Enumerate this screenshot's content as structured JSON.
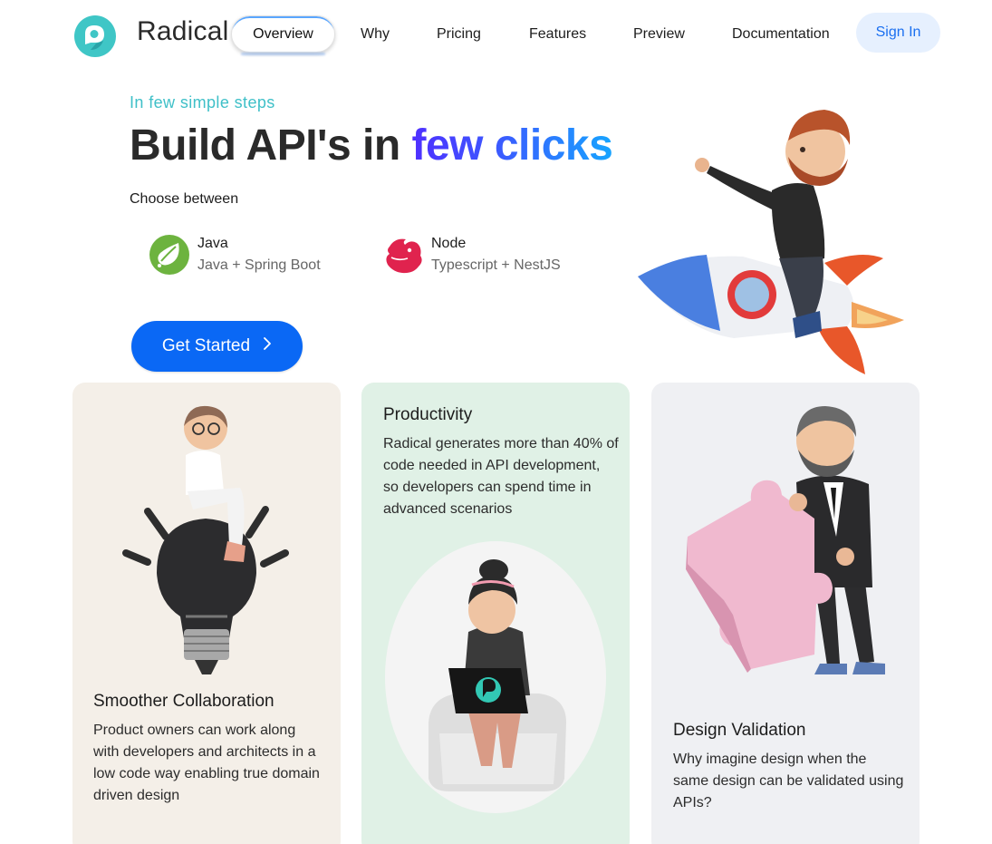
{
  "brand": {
    "name": "Radical",
    "color": "#3fc6c6"
  },
  "nav": {
    "active": "Overview",
    "items": [
      "Why",
      "Pricing",
      "Features",
      "Preview",
      "Documentation"
    ],
    "signin": "Sign In"
  },
  "hero": {
    "eyebrow": "In few simple steps",
    "headline_plain": "Build API's in ",
    "headline_accent": "few clicks",
    "choose": "Choose between",
    "options": [
      {
        "title": "Java",
        "subtitle": "Java + Spring Boot",
        "icon": "spring-leaf-icon",
        "color": "#6db33f"
      },
      {
        "title": "Node",
        "subtitle": "Typescript + NestJS",
        "icon": "nestjs-icon",
        "color": "#e0234e"
      }
    ],
    "cta": "Get Started",
    "cta_icon": "chevron-right-icon",
    "art": "man-riding-rocket-illustration"
  },
  "cards": [
    {
      "title": "Smoother Collaboration",
      "body": "Product owners can work along with developers and architects in a low code way enabling true domain driven design",
      "art": "person-on-lightbulb-illustration",
      "background": "#f4efe8"
    },
    {
      "title": "Productivity",
      "body": "Radical generates more than 40% of code needed in API development, so developers can spend time in advanced scenarios",
      "art": "girl-with-laptop-illustration",
      "background": "#e0f1e6"
    },
    {
      "title": "Design Validation",
      "body": "Why imagine design when the same design can be validated using APIs?",
      "art": "man-with-puzzle-piece-illustration",
      "background": "#eff0f3"
    }
  ],
  "colors": {
    "primary": "#0a68f5",
    "accent_teal": "#3fc0c8",
    "gradient_start": "#4f2fff",
    "gradient_end": "#17a4ff"
  }
}
